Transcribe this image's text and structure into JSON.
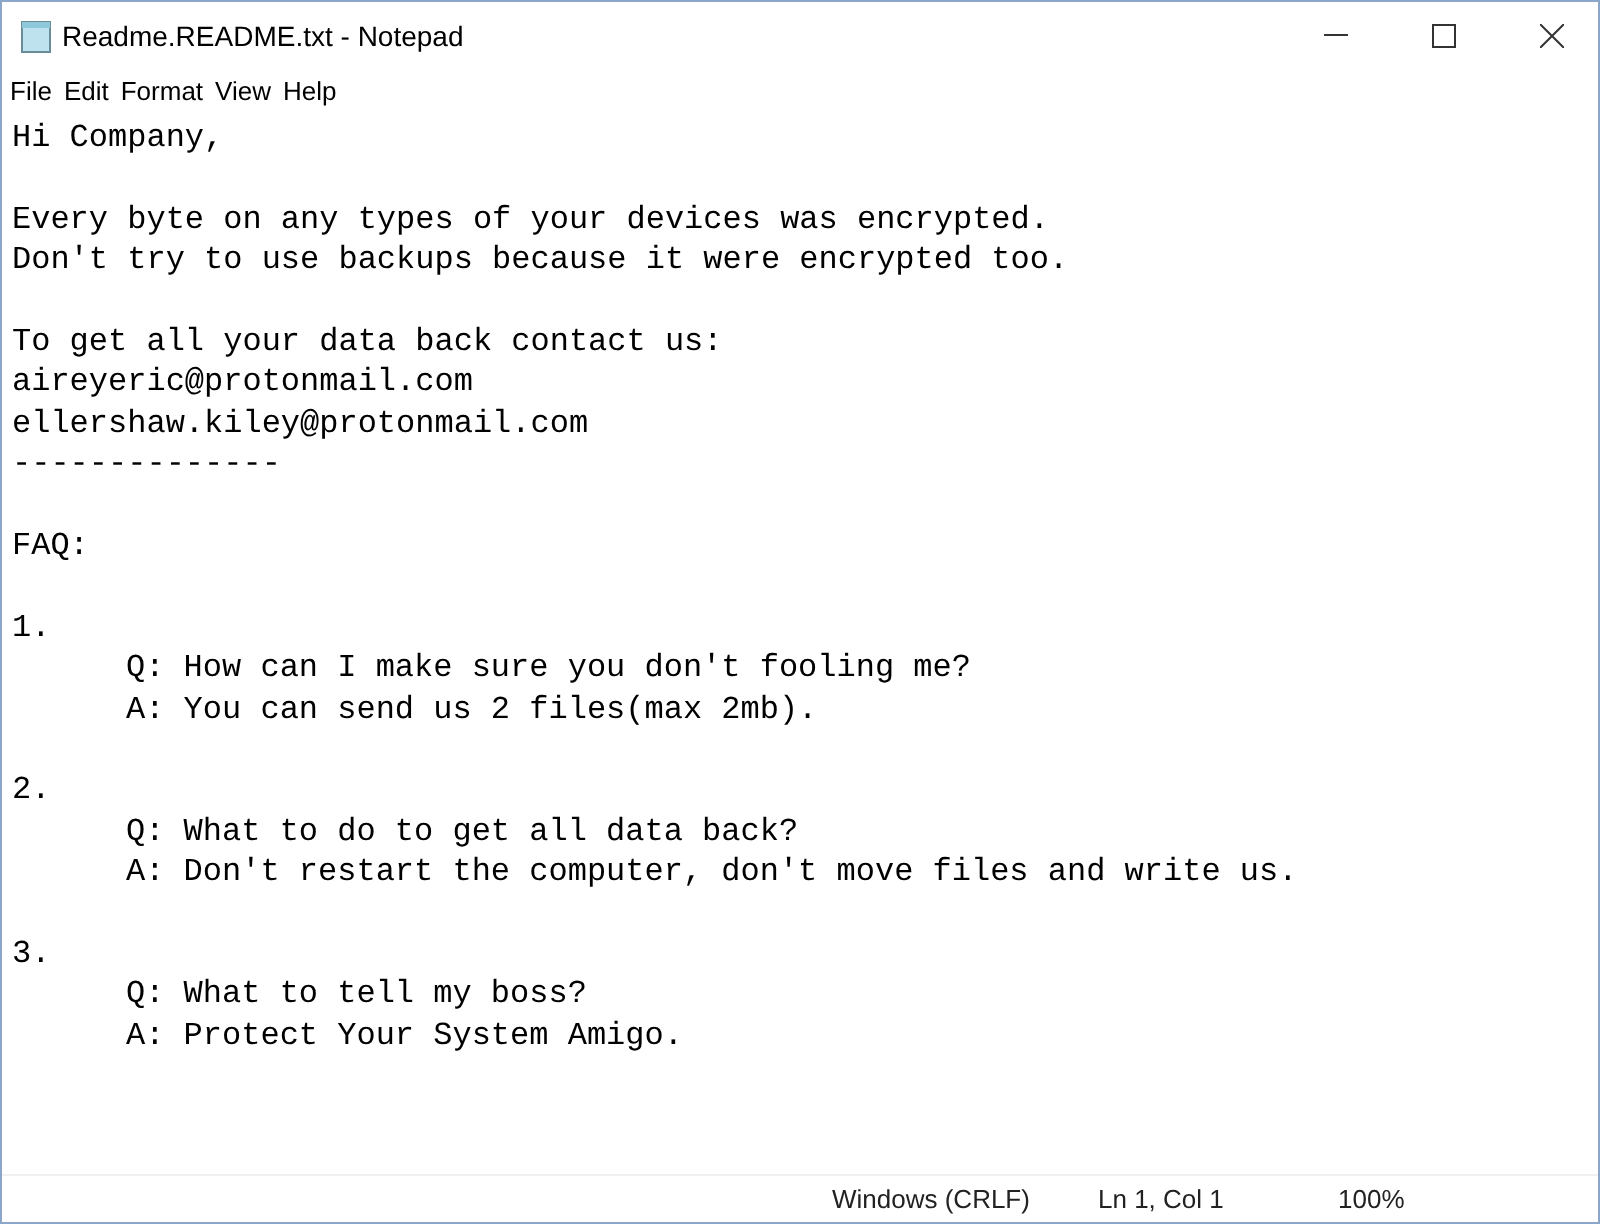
{
  "window": {
    "title": "Readme.README.txt - Notepad"
  },
  "menu": [
    "File",
    "Edit",
    "Format",
    "View",
    "Help"
  ],
  "document": {
    "blocks": [
      [
        {
          "text": "Hi Company,",
          "indented": false
        }
      ],
      [
        {
          "text": "Every byte on any types of your devices was encrypted.",
          "indented": false
        },
        {
          "text": "Don't try to use backups because it were encrypted too.",
          "indented": false
        }
      ],
      [
        {
          "text": "To get all your data back contact us:",
          "indented": false
        },
        {
          "text": "aireyeric@protonmail.com",
          "indented": false
        },
        {
          "text": "ellershaw.kiley@protonmail.com",
          "indented": false
        },
        {
          "text": "--------------",
          "indented": false
        }
      ],
      [
        {
          "text": "FAQ:",
          "indented": false
        }
      ],
      [
        {
          "text": "1.",
          "indented": false
        },
        {
          "text": "Q: How can I make sure you don't fooling me?",
          "indented": true
        },
        {
          "text": "A: You can send us 2 files(max 2mb).",
          "indented": true
        }
      ],
      [
        {
          "text": "2.",
          "indented": false
        },
        {
          "text": "Q: What to do to get all data back?",
          "indented": true
        },
        {
          "text": "A: Don't restart the computer, don't move files and write us.",
          "indented": true
        }
      ],
      [
        {
          "text": "3.",
          "indented": false
        },
        {
          "text": "Q: What to tell my boss?",
          "indented": true
        },
        {
          "text": "A: Protect Your System Amigo.",
          "indented": true
        }
      ]
    ]
  },
  "status_bar": {
    "line_ending": "Windows (CRLF)",
    "position": "Ln 1, Col 1",
    "zoom": "100%"
  }
}
